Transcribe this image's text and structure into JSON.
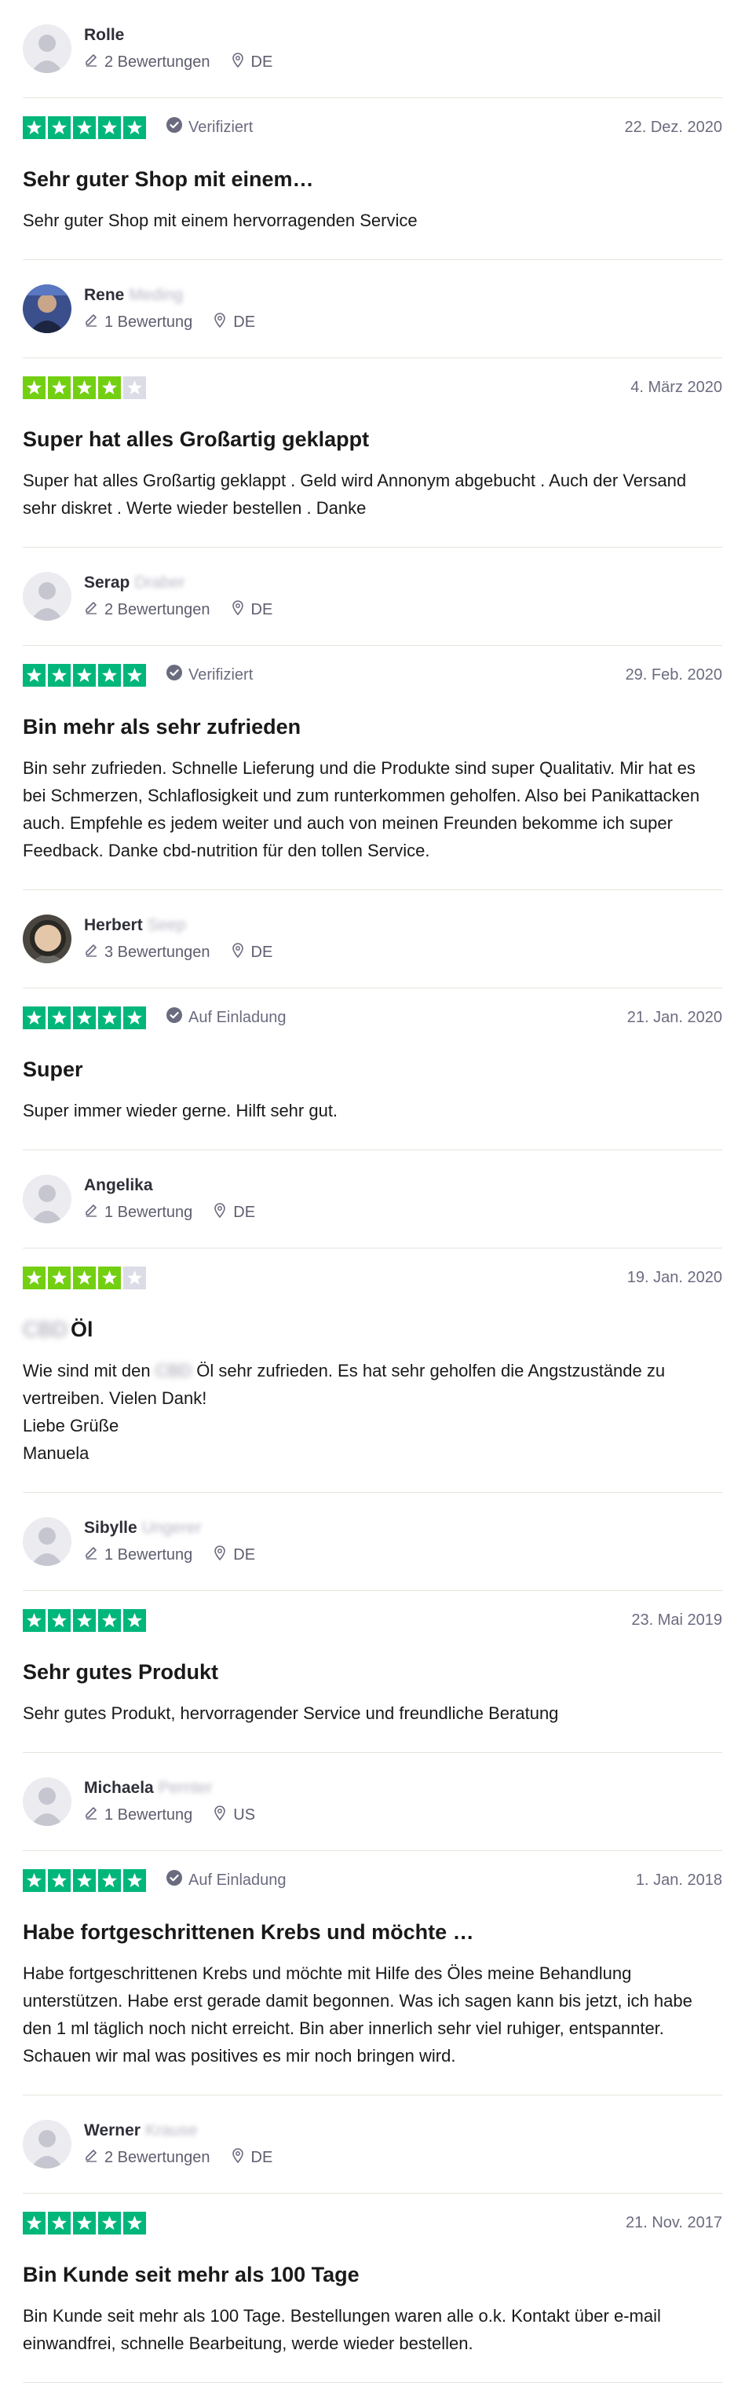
{
  "colors": {
    "star5": "#00b67a",
    "star4": "#73cf11",
    "star_empty": "#dcdce6",
    "badge": "#6b6b80"
  },
  "icons": {
    "reviews": "pencil-icon",
    "location": "location-pin-icon",
    "verified": "check-circle-icon",
    "star": "star-icon"
  },
  "reviews": [
    {
      "name": "Rolle",
      "surname": "",
      "reviews_count": "2 Bewertungen",
      "country": "DE",
      "avatar": "placeholder",
      "rating": 5,
      "badge": "Verifiziert",
      "date": "22. Dez. 2020",
      "title_blur": "",
      "title": "Sehr guter Shop mit einem…",
      "text": "Sehr guter Shop mit einem hervorragenden Service"
    },
    {
      "name": "Rene",
      "surname": "Meding",
      "reviews_count": "1 Bewertung",
      "country": "DE",
      "avatar": "photo-blue",
      "rating": 4,
      "badge": "",
      "date": "4. März 2020",
      "title_blur": "",
      "title": "Super hat alles Großartig geklappt",
      "text": "Super hat alles Großartig geklappt . Geld wird Annonym abgebucht . Auch der Versand sehr diskret . Werte wieder bestellen . Danke"
    },
    {
      "name": "Serap",
      "surname": "Draber",
      "reviews_count": "2 Bewertungen",
      "country": "DE",
      "avatar": "placeholder",
      "rating": 5,
      "badge": "Verifiziert",
      "date": "29. Feb. 2020",
      "title_blur": "",
      "title": "Bin mehr als sehr zufrieden",
      "text": "Bin sehr zufrieden. Schnelle Lieferung und die Produkte sind super Qualitativ. Mir hat es bei Schmerzen, Schlaflosigkeit und zum runterkommen geholfen. Also bei Panikattacken auch. Empfehle es jedem weiter und auch von meinen Freunden bekomme ich super Feedback. Danke cbd-nutrition für den tollen Service."
    },
    {
      "name": "Herbert",
      "surname": "Seep",
      "reviews_count": "3 Bewertungen",
      "country": "DE",
      "avatar": "photo-face",
      "rating": 5,
      "badge": "Auf Einladung",
      "date": "21. Jan. 2020",
      "title_blur": "",
      "title": "Super",
      "text": "Super immer wieder gerne. Hilft sehr gut."
    },
    {
      "name": "Angelika",
      "surname": "",
      "reviews_count": "1 Bewertung",
      "country": "DE",
      "avatar": "placeholder",
      "rating": 4,
      "badge": "",
      "date": "19. Jan. 2020",
      "title_blur": "CBD",
      "title": "Öl",
      "text_before": "Wie sind mit den ",
      "text_blur": "CBD",
      "text_after": " Öl sehr zufrieden. Es hat sehr geholfen die Angstzustände zu vertreiben. Vielen Dank!\nLiebe Grüße\nManuela"
    },
    {
      "name": "Sibylle",
      "surname": "Ungerer",
      "reviews_count": "1 Bewertung",
      "country": "DE",
      "avatar": "placeholder",
      "rating": 5,
      "badge": "",
      "date": "23. Mai 2019",
      "title_blur": "",
      "title": "Sehr gutes Produkt",
      "text": "Sehr gutes Produkt, hervorragender Service und freundliche Beratung"
    },
    {
      "name": "Michaela",
      "surname": "Pernter",
      "reviews_count": "1 Bewertung",
      "country": "US",
      "avatar": "placeholder",
      "rating": 5,
      "badge": "Auf Einladung",
      "date": "1. Jan. 2018",
      "title_blur": "",
      "title": "Habe fortgeschrittenen Krebs und möchte …",
      "text": "Habe fortgeschrittenen Krebs und möchte mit Hilfe des Öles meine Behandlung unterstützen. Habe erst gerade damit begonnen. Was ich sagen kann bis jetzt, ich habe den 1 ml täglich noch nicht erreicht. Bin aber innerlich sehr viel ruhiger, entspannter. Schauen wir mal was positives es mir noch bringen wird."
    },
    {
      "name": "Werner",
      "surname": "Krause",
      "reviews_count": "2 Bewertungen",
      "country": "DE",
      "avatar": "placeholder",
      "rating": 5,
      "badge": "",
      "date": "21. Nov. 2017",
      "title_blur": "",
      "title": "Bin Kunde seit mehr als 100 Tage",
      "text": "Bin Kunde seit mehr als 100 Tage. Bestellungen waren alle o.k. Kontakt über e-mail einwandfrei, schnelle Bearbeitung, werde wieder bestellen."
    }
  ]
}
